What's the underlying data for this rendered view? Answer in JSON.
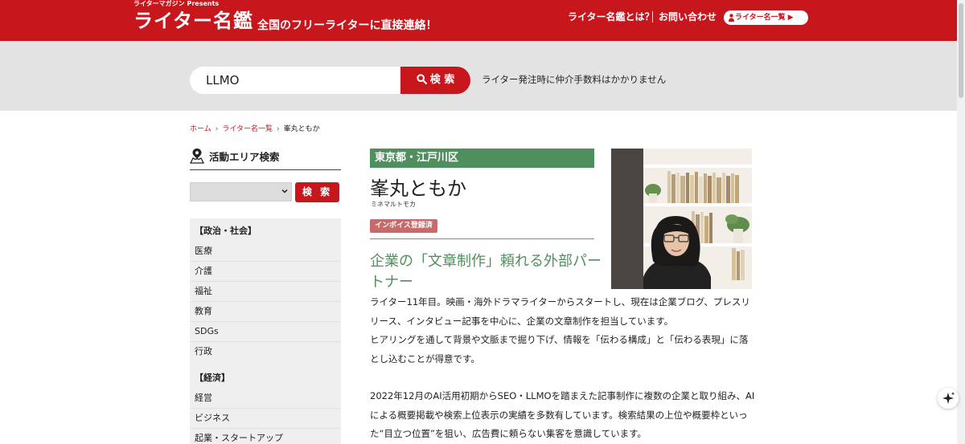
{
  "header": {
    "presents": "ライターマガジン Presents",
    "logo": "ライター名鑑",
    "tagline": "全国のフリーライターに直接連絡！",
    "nav_about": "ライター名鑑とは？",
    "nav_contact": "お問い合わせ",
    "nav_list": "ライター名一覧 ▶",
    "brand_color": "#c8161d"
  },
  "search": {
    "value": "LLMO",
    "button_label": "検 索",
    "note": "ライター発注時に仲介手数料はかかりません"
  },
  "breadcrumb": {
    "home": "ホーム",
    "list": "ライター名一覧",
    "current": "峯丸ともか"
  },
  "sidebar": {
    "area_title": "活動エリア検索",
    "area_button": "検 索",
    "categories": [
      {
        "heading": "【政治・社会】",
        "items": [
          "医療",
          "介護",
          "福祉",
          "教育",
          "SDGs",
          "行政"
        ]
      },
      {
        "heading": "【経済】",
        "items": [
          "経営",
          "ビジネス",
          "起業・スタートアップ"
        ]
      }
    ]
  },
  "profile": {
    "area": "東京都・江戸川区",
    "name": "峯丸ともか",
    "kana": "ミネマルトモカ",
    "invoice": "インボイス登録済",
    "catchcopy": "企業の「文章制作」頼れる外部パートナー",
    "accent_color": "#4f8f5e",
    "bio": [
      "ライター11年目。映画・海外ドラマライターからスタートし、現在は企業ブログ、プレスリリース、インタビュー記事を中心に、企業の文章制作を担当しています。",
      "ヒアリングを通して背景や文脈まで掘り下げ、情報を「伝わる構成」と「伝わる表現」に落とし込むことが得意です。",
      "",
      "2022年12月のAI活用初期からSEO・LLMOを踏まえた記事制作に複数の企業と取り組み、AIによる概要掲載や検索上位表示の実績を多数有しています。検索結果の上位や概要枠といった“目立つ位置”を狙い、広告費に頼らない集客を意識しています。"
    ]
  }
}
